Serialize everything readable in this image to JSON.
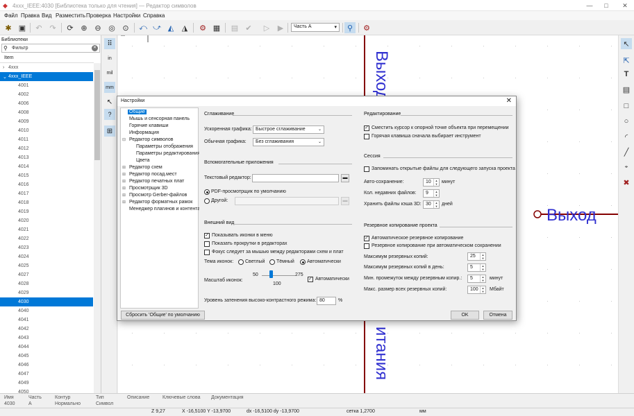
{
  "window": {
    "title": "4xxx_IEEE:4030 [Библиотека только для чтения] — Редактор символов"
  },
  "menu": [
    "Файл",
    "Правка",
    "Вид",
    "Разместить",
    "Проверка",
    "Настройки",
    "Справка"
  ],
  "toolbar": {
    "unit_select": "Часть A"
  },
  "library": {
    "header": "Библиотеки",
    "filter_placeholder": "Фильтр",
    "column": "Item",
    "root_collapsed": "4xxx",
    "root_expanded": "4xxx_IEEE",
    "items": [
      "4001",
      "4002",
      "4006",
      "4008",
      "4009",
      "4010",
      "4011",
      "4012",
      "4013",
      "4014",
      "4015",
      "4016",
      "4017",
      "4018",
      "4019",
      "4020",
      "4021",
      "4022",
      "4023",
      "4024",
      "4025",
      "4027",
      "4028",
      "4029",
      "4030",
      "4040",
      "4041",
      "4042",
      "4043",
      "4044",
      "4045",
      "4046",
      "4047",
      "4049",
      "4050",
      "4051"
    ],
    "selected": "4030"
  },
  "left_toolbar": {
    "in": "in",
    "mil": "mil",
    "mm": "mm"
  },
  "canvas": {
    "pin_top": "Выход п",
    "pin_right": "Выход",
    "pin_bottom": "итания"
  },
  "info": {
    "labels": [
      "Имя",
      "Часть",
      "Контур",
      "Тип",
      "Описание",
      "Ключевые слова",
      "Документация"
    ],
    "values": [
      "4030",
      "A",
      "Нормально",
      "Символ"
    ]
  },
  "status": {
    "z": "Z 9,27",
    "xy": "X -16,5100  Y -13,9700",
    "dxy": "dx -16,5100  dy -13,9700",
    "grid": "сетка 1,2700",
    "units": "мм"
  },
  "dialog": {
    "title": "Настройки",
    "tree": [
      "Общие",
      "Мышь и сенсорная панель",
      "Горячие клавиши",
      "Информация",
      "Редактор символов",
      "Параметры отображения",
      "Параметры редактирования",
      "Цвета",
      "Редактор схем",
      "Редактор посад.мест",
      "Редактор печатных плат",
      "Просмотрщик 3D",
      "Просмотр Gerber-файлов",
      "Редактор форматных рамок",
      "Менеджер плагинов и контента"
    ],
    "rendering": {
      "title": "Сглаживание",
      "accel_label": "Ускоренная графика:",
      "accel_value": "Быстрое сглаживание",
      "fallback_label": "Обычная графика:",
      "fallback_value": "Без сглаживания"
    },
    "helpers": {
      "title": "Вспомогательные приложения",
      "text_editor_label": "Текстовый редактор:",
      "text_editor_value": "",
      "pdf_default": "PDF-просмотрщик по умолчанию",
      "pdf_other": "Другой:"
    },
    "appearance": {
      "title": "Внешний вид",
      "show_icons": "Показывать иконки в меню",
      "show_scrollbars": "Показать прокрутки в редакторах",
      "focus_follow": "Фокус следует за мышью между редакторами схем и плат",
      "icon_theme_label": "Тема иконок:",
      "theme_light": "Светлый",
      "theme_dark": "Тёмный",
      "theme_auto": "Автоматически",
      "icon_scale_label": "Масштаб иконок:",
      "scale_min": "50",
      "scale_max": "275",
      "scale_value": "100",
      "scale_auto": "Автоматически",
      "contrast_label": "Уровень затенения высоко-контрастного режима:",
      "contrast_value": "80",
      "contrast_unit": "%"
    },
    "editing": {
      "title": "Редактирование",
      "warp_mouse": "Сместить курсор к опорной точке объекта при перемещении",
      "first_hotkey": "Горячая клавиша сначала выбирает инструмент"
    },
    "session": {
      "title": "Сессия",
      "remember_files": "Запоминать открытые файлы для следующего запуска проекта",
      "autosave_label": "Авто-сохранение:",
      "autosave_value": "10",
      "autosave_unit": "минут",
      "recent_label": "Кол. недавних файлов:",
      "recent_value": "9",
      "cache_label": "Хранить файлы кэша 3D:",
      "cache_value": "30",
      "cache_unit": "дней"
    },
    "backup": {
      "title": "Резервное копирование проекта",
      "auto_backup": "Автоматическое резервное копирование",
      "backup_on_save": "Резервное копирование при автоматическом сохранении",
      "max_label": "Максимум резервных копий:",
      "max_value": "25",
      "per_day_label": "Максимум резервных копий в день:",
      "per_day_value": "5",
      "interval_label": "Мин. промежуток между резервным копир.:",
      "interval_value": "5",
      "interval_unit": "минут",
      "size_label": "Макс. размер всех резервных копий:",
      "size_value": "100",
      "size_unit": "Мбайт"
    },
    "buttons": {
      "reset": "Сбросить 'Общие' по умолчанию",
      "ok": "OK",
      "cancel": "Отмена"
    }
  },
  "colors": {
    "accent": "#0078d7",
    "pin": "#840000",
    "pin_text": "#3030d0",
    "grid": "#c8c8c8"
  }
}
